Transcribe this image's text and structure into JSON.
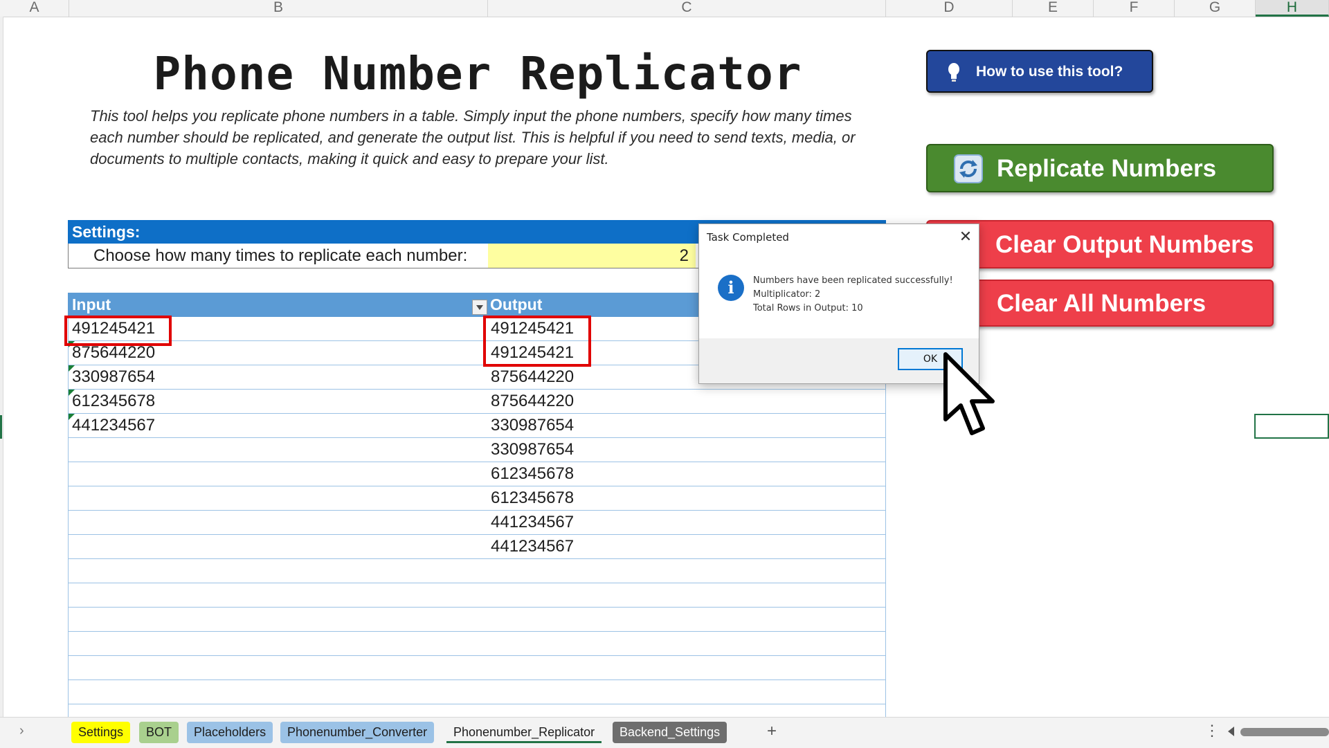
{
  "columns": [
    "A",
    "B",
    "C",
    "D",
    "E",
    "F",
    "G",
    "H"
  ],
  "title": "Phone Number Replicator",
  "description": "This tool helps you replicate phone numbers in a table. Simply input the phone numbers, specify how many times each number should be replicated, and generate the output list. This is helpful if you need to send texts, media, or documents to multiple contacts, making it quick and easy to prepare your list.",
  "settings": {
    "header": "Settings:",
    "label": "Choose how many times to replicate each number:",
    "value": "2"
  },
  "table": {
    "input_header": "Input",
    "output_header": "Output",
    "input": [
      "491245421",
      "875644220",
      "330987654",
      "612345678",
      "441234567"
    ],
    "output": [
      "491245421",
      "491245421",
      "875644220",
      "875644220",
      "330987654",
      "330987654",
      "612345678",
      "612345678",
      "441234567",
      "441234567"
    ]
  },
  "buttons": {
    "how_to": "How to use this tool?",
    "replicate": "Replicate Numbers",
    "clear_output": "Clear Output Numbers",
    "clear_all": "Clear All Numbers"
  },
  "dialog": {
    "title": "Task Completed",
    "line1": "Numbers have been replicated successfully!",
    "line2": "Multiplicator: 2",
    "line3": "Total Rows in Output: 10",
    "ok": "OK"
  },
  "tabs": {
    "settings": "Settings",
    "bot": "BOT",
    "placeholders": "Placeholders",
    "converter": "Phonenumber_Converter",
    "replicator": "Phonenumber_Replicator",
    "backend": "Backend_Settings",
    "add": "+",
    "more": "⋮",
    "nav": "›"
  },
  "colors": {
    "settings_header": "#0e6fc7",
    "table_header": "#5b9bd5",
    "replicate_button": "#4a8a2f",
    "clear_button": "#ee3f4a",
    "how_button": "#23479b",
    "highlight": "#e00000"
  },
  "icons": [
    "bulb-icon",
    "refresh-icon",
    "info-icon",
    "close-icon",
    "filter-icon",
    "mouse-cursor-icon"
  ]
}
